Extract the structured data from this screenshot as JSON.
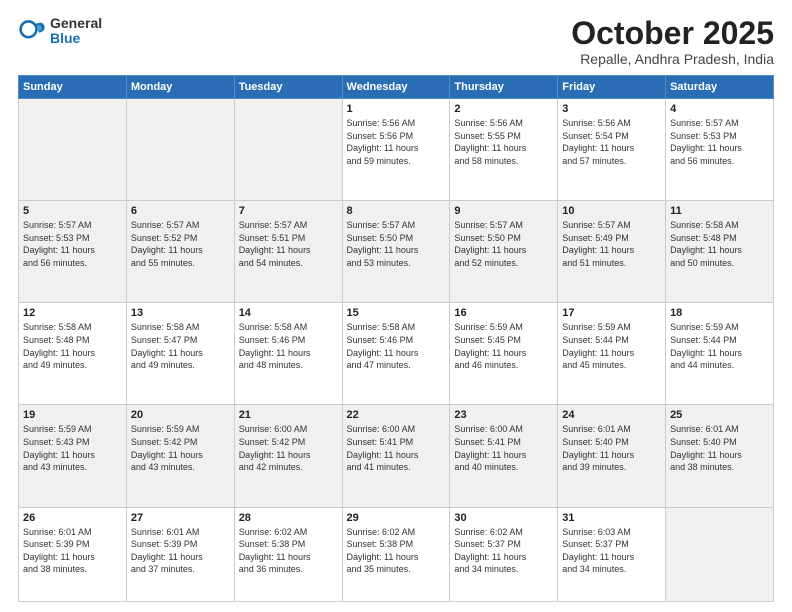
{
  "logo": {
    "general": "General",
    "blue": "Blue"
  },
  "header": {
    "month": "October 2025",
    "location": "Repalle, Andhra Pradesh, India"
  },
  "weekdays": [
    "Sunday",
    "Monday",
    "Tuesday",
    "Wednesday",
    "Thursday",
    "Friday",
    "Saturday"
  ],
  "weeks": [
    [
      {
        "day": "",
        "info": ""
      },
      {
        "day": "",
        "info": ""
      },
      {
        "day": "",
        "info": ""
      },
      {
        "day": "1",
        "info": "Sunrise: 5:56 AM\nSunset: 5:56 PM\nDaylight: 11 hours\nand 59 minutes."
      },
      {
        "day": "2",
        "info": "Sunrise: 5:56 AM\nSunset: 5:55 PM\nDaylight: 11 hours\nand 58 minutes."
      },
      {
        "day": "3",
        "info": "Sunrise: 5:56 AM\nSunset: 5:54 PM\nDaylight: 11 hours\nand 57 minutes."
      },
      {
        "day": "4",
        "info": "Sunrise: 5:57 AM\nSunset: 5:53 PM\nDaylight: 11 hours\nand 56 minutes."
      }
    ],
    [
      {
        "day": "5",
        "info": "Sunrise: 5:57 AM\nSunset: 5:53 PM\nDaylight: 11 hours\nand 56 minutes."
      },
      {
        "day": "6",
        "info": "Sunrise: 5:57 AM\nSunset: 5:52 PM\nDaylight: 11 hours\nand 55 minutes."
      },
      {
        "day": "7",
        "info": "Sunrise: 5:57 AM\nSunset: 5:51 PM\nDaylight: 11 hours\nand 54 minutes."
      },
      {
        "day": "8",
        "info": "Sunrise: 5:57 AM\nSunset: 5:50 PM\nDaylight: 11 hours\nand 53 minutes."
      },
      {
        "day": "9",
        "info": "Sunrise: 5:57 AM\nSunset: 5:50 PM\nDaylight: 11 hours\nand 52 minutes."
      },
      {
        "day": "10",
        "info": "Sunrise: 5:57 AM\nSunset: 5:49 PM\nDaylight: 11 hours\nand 51 minutes."
      },
      {
        "day": "11",
        "info": "Sunrise: 5:58 AM\nSunset: 5:48 PM\nDaylight: 11 hours\nand 50 minutes."
      }
    ],
    [
      {
        "day": "12",
        "info": "Sunrise: 5:58 AM\nSunset: 5:48 PM\nDaylight: 11 hours\nand 49 minutes."
      },
      {
        "day": "13",
        "info": "Sunrise: 5:58 AM\nSunset: 5:47 PM\nDaylight: 11 hours\nand 49 minutes."
      },
      {
        "day": "14",
        "info": "Sunrise: 5:58 AM\nSunset: 5:46 PM\nDaylight: 11 hours\nand 48 minutes."
      },
      {
        "day": "15",
        "info": "Sunrise: 5:58 AM\nSunset: 5:46 PM\nDaylight: 11 hours\nand 47 minutes."
      },
      {
        "day": "16",
        "info": "Sunrise: 5:59 AM\nSunset: 5:45 PM\nDaylight: 11 hours\nand 46 minutes."
      },
      {
        "day": "17",
        "info": "Sunrise: 5:59 AM\nSunset: 5:44 PM\nDaylight: 11 hours\nand 45 minutes."
      },
      {
        "day": "18",
        "info": "Sunrise: 5:59 AM\nSunset: 5:44 PM\nDaylight: 11 hours\nand 44 minutes."
      }
    ],
    [
      {
        "day": "19",
        "info": "Sunrise: 5:59 AM\nSunset: 5:43 PM\nDaylight: 11 hours\nand 43 minutes."
      },
      {
        "day": "20",
        "info": "Sunrise: 5:59 AM\nSunset: 5:42 PM\nDaylight: 11 hours\nand 43 minutes."
      },
      {
        "day": "21",
        "info": "Sunrise: 6:00 AM\nSunset: 5:42 PM\nDaylight: 11 hours\nand 42 minutes."
      },
      {
        "day": "22",
        "info": "Sunrise: 6:00 AM\nSunset: 5:41 PM\nDaylight: 11 hours\nand 41 minutes."
      },
      {
        "day": "23",
        "info": "Sunrise: 6:00 AM\nSunset: 5:41 PM\nDaylight: 11 hours\nand 40 minutes."
      },
      {
        "day": "24",
        "info": "Sunrise: 6:01 AM\nSunset: 5:40 PM\nDaylight: 11 hours\nand 39 minutes."
      },
      {
        "day": "25",
        "info": "Sunrise: 6:01 AM\nSunset: 5:40 PM\nDaylight: 11 hours\nand 38 minutes."
      }
    ],
    [
      {
        "day": "26",
        "info": "Sunrise: 6:01 AM\nSunset: 5:39 PM\nDaylight: 11 hours\nand 38 minutes."
      },
      {
        "day": "27",
        "info": "Sunrise: 6:01 AM\nSunset: 5:39 PM\nDaylight: 11 hours\nand 37 minutes."
      },
      {
        "day": "28",
        "info": "Sunrise: 6:02 AM\nSunset: 5:38 PM\nDaylight: 11 hours\nand 36 minutes."
      },
      {
        "day": "29",
        "info": "Sunrise: 6:02 AM\nSunset: 5:38 PM\nDaylight: 11 hours\nand 35 minutes."
      },
      {
        "day": "30",
        "info": "Sunrise: 6:02 AM\nSunset: 5:37 PM\nDaylight: 11 hours\nand 34 minutes."
      },
      {
        "day": "31",
        "info": "Sunrise: 6:03 AM\nSunset: 5:37 PM\nDaylight: 11 hours\nand 34 minutes."
      },
      {
        "day": "",
        "info": ""
      }
    ]
  ]
}
